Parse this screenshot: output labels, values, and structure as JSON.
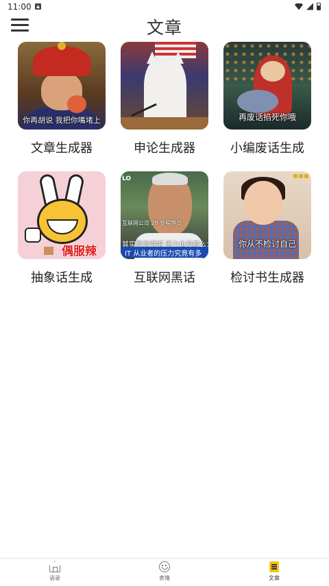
{
  "status_bar": {
    "time": "11:00"
  },
  "header": {
    "title": "文章",
    "menu_icon": "hamburger-menu-icon"
  },
  "cards": [
    {
      "label": "文章生成器",
      "overlay": "你再胡说  我把你嘴堵上"
    },
    {
      "label": "申论生成器",
      "overlay": ""
    },
    {
      "label": "小编废话生成",
      "overlay": "再废话掐死你哦"
    },
    {
      "label": "抽象话生成",
      "overlay": "偶服辣"
    },
    {
      "label": "互联网黑话",
      "overlay_lines": [
        "互联网公司 28 岁程序员",
        "其实我觉得吧  压力也没那么大",
        "IT 从业者的压力究竟有多"
      ]
    },
    {
      "label": "检讨书生成器",
      "overlay": "你从不检讨自己"
    }
  ],
  "bottom_nav": {
    "items": [
      {
        "label": "语录",
        "icon": "home-icon",
        "active": false
      },
      {
        "label": "表情",
        "icon": "smile-icon",
        "active": false
      },
      {
        "label": "文章",
        "icon": "document-icon",
        "active": true
      }
    ]
  }
}
